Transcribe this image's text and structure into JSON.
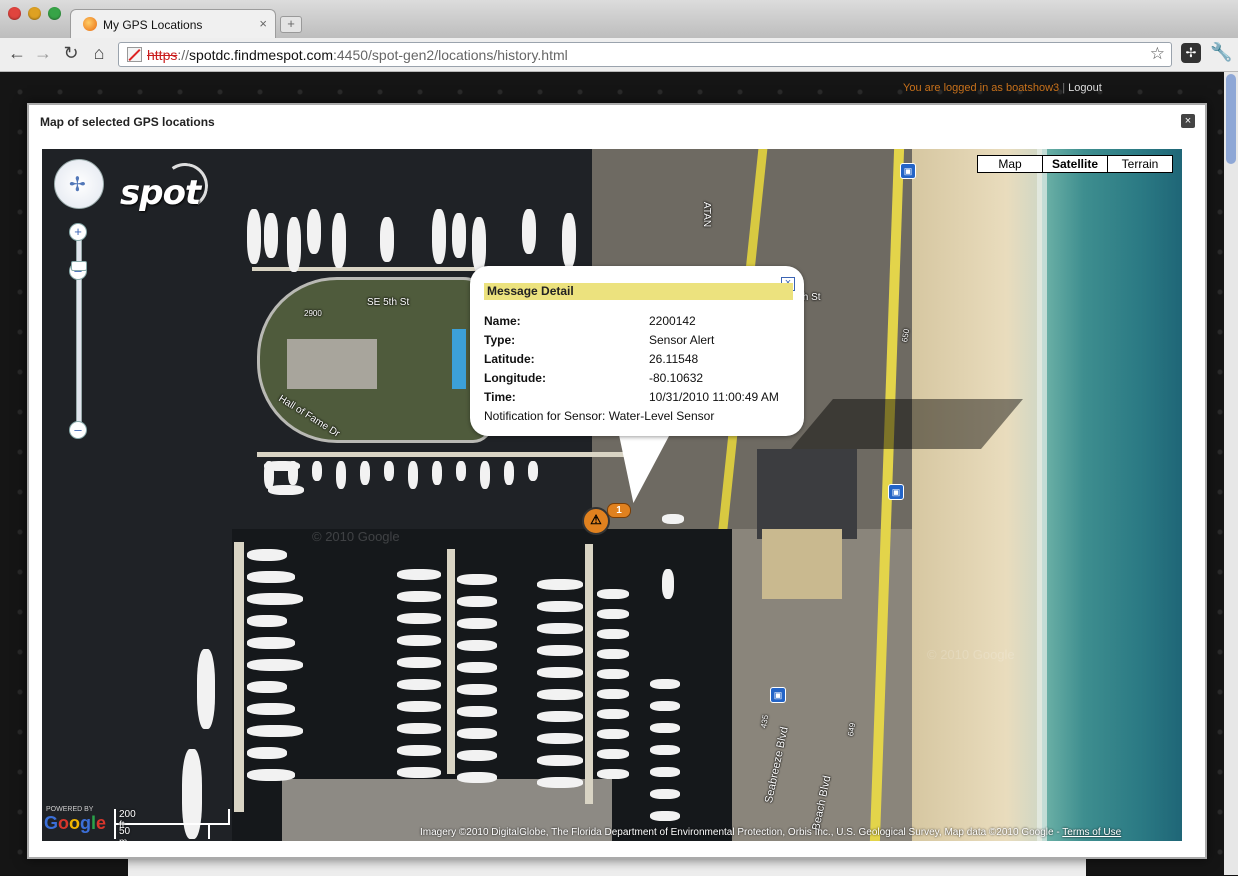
{
  "browser": {
    "tab_title": "My GPS Locations",
    "tab_close": "×",
    "new_tab": "+",
    "url_scheme": "https",
    "url_sep": "://",
    "url_host": "spotdc.findmespot.com",
    "url_rest": ":4450/spot-gen2/locations/history.html"
  },
  "header": {
    "logged_in_text": "You are logged in as boatshow3",
    "separator": "|",
    "logout_label": "Logout"
  },
  "dialog": {
    "title": "Map of selected GPS locations",
    "close_label": "×"
  },
  "map": {
    "map_types": [
      {
        "label": "Map",
        "active": false
      },
      {
        "label": "Satellite",
        "active": true
      },
      {
        "label": "Terrain",
        "active": false
      }
    ],
    "street_labels": {
      "se5th": "SE 5th St",
      "hall": "Hall of Fame Dr",
      "seabreeze": "Seabreeze Blvd",
      "beach": "Beach Blvd",
      "atan": "ATAN",
      "th_st": "th St",
      "n2900": "2900",
      "r435": "435",
      "r650": "650",
      "r649": "649"
    },
    "logo_text": "spot",
    "scale_ft": "200 ft",
    "scale_m": "50 m",
    "powered_by": "POWERED BY",
    "google_letters": [
      "G",
      "o",
      "o",
      "g",
      "l",
      "e"
    ],
    "copyright": "Imagery ©2010 DigitalGlobe, The Florida Department of Environmental Protection, Orbis Inc., U.S. Geological Survey, Map data ©2010 Google - ",
    "terms": "Terms of Use",
    "watermark": "© 2010 Google",
    "marker_count": "1",
    "marker_symbol": "⚠"
  },
  "message_detail": {
    "header": "Message Detail",
    "close": "×",
    "rows": [
      {
        "key": "Name:",
        "value": "2200142"
      },
      {
        "key": "Type:",
        "value": "Sensor Alert"
      },
      {
        "key": "Latitude:",
        "value": "26.11548"
      },
      {
        "key": "Longitude:",
        "value": "-80.10632"
      },
      {
        "key": "Time:",
        "value": "10/31/2010 11:00:49 AM"
      }
    ],
    "note": "Notification for Sensor: Water-Level Sensor"
  },
  "icons": {
    "back": "back-arrow-icon",
    "forward": "forward-arrow-icon",
    "reload": "reload-icon",
    "home": "home-icon",
    "star": "bookmark-star-icon",
    "wrench": "wrench-icon"
  }
}
